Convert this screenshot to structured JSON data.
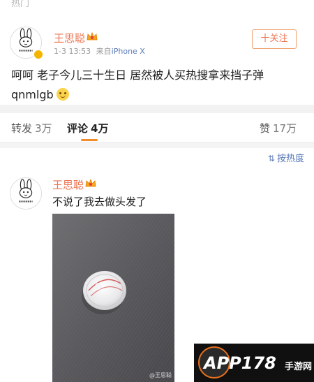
{
  "top_strip": {
    "label": "热门"
  },
  "post": {
    "username": "王思聪",
    "time": "1-3 13:53",
    "source_prefix": "来自",
    "source": "iPhone X",
    "follow_label": "十关注",
    "text": "呵呵 老子今儿三十生日 居然被人买热搜拿来挡子弹 qnmlgb"
  },
  "tabs": [
    {
      "label": "转发",
      "count": "3万"
    },
    {
      "label": "评论",
      "count": "4万"
    },
    {
      "label": "赞",
      "count": "17万"
    }
  ],
  "sort": {
    "label": "按热度",
    "icon": "sort-icon"
  },
  "comment": {
    "username": "王思聪",
    "text": "不说了我去做头发了",
    "photo_watermark": "@王思聪"
  },
  "watermark": {
    "main": "APP178",
    "sub": "手游网"
  },
  "colors": {
    "accent": "#eb7350",
    "tab_underline": "#f28b2c",
    "link": "#5a7ab8",
    "verified": "#f5b400"
  }
}
